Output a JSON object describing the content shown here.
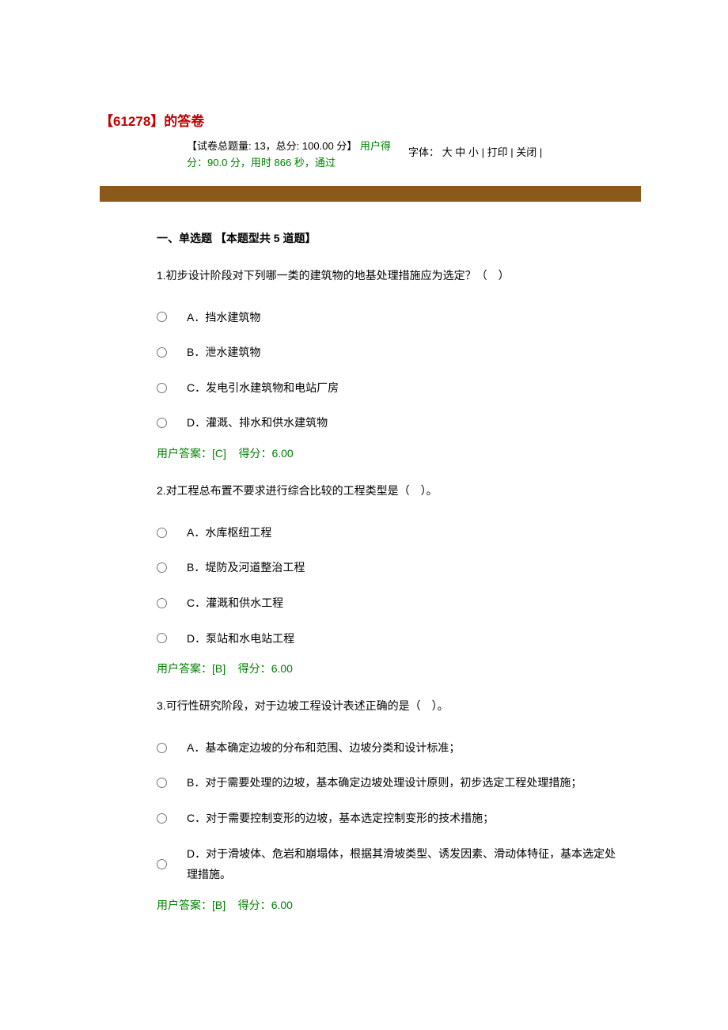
{
  "title_prefix": "【",
  "title_id": "61278",
  "title_suffix": "】的答卷",
  "meta": {
    "line1a": "【试卷总题量: 13，总分: 100.00 分】",
    "line1b": "用户得",
    "line2a": "分：",
    "line2b": "90.0 分，用时 866 秒，通过",
    "font_label": "字体：",
    "font_large": "大",
    "font_medium": "中",
    "font_small": "小",
    "sep": " | ",
    "print": "打印",
    "close": "关闭"
  },
  "section_title": "一、单选题 【本题型共 5 道题】",
  "questions": [
    {
      "stem": "1.初步设计阶段对下列哪一类的建筑物的地基处理措施应为选定？（　）",
      "options": [
        "A．挡水建筑物",
        "B．泄水建筑物",
        "C．发电引水建筑物和电站厂房",
        "D．灌溉、排水和供水建筑物"
      ],
      "answer_label": "用户答案：",
      "answer_value": "[C]",
      "score_label": "    得分：",
      "score_value": "6.00"
    },
    {
      "stem": "2.对工程总布置不要求进行综合比较的工程类型是（　）。",
      "options": [
        "A．水库枢纽工程",
        "B．堤防及河道整治工程",
        "C．灌溉和供水工程",
        "D．泵站和水电站工程"
      ],
      "answer_label": "用户答案：",
      "answer_value": "[B]",
      "score_label": "    得分：",
      "score_value": "6.00"
    },
    {
      "stem": "3.可行性研究阶段，对于边坡工程设计表述正确的是（　）。",
      "options": [
        "A．基本确定边坡的分布和范围、边坡分类和设计标准；",
        "B．对于需要处理的边坡，基本确定边坡处理设计原则，初步选定工程处理措施；",
        "C．对于需要控制变形的边坡，基本选定控制变形的技术措施；",
        "D．对于滑坡体、危岩和崩塌体，根据其滑坡类型、诱发因素、滑动体特征，基本选定处理措施。"
      ],
      "answer_label": "用户答案：",
      "answer_value": "[B]",
      "score_label": "    得分：",
      "score_value": "6.00"
    }
  ]
}
